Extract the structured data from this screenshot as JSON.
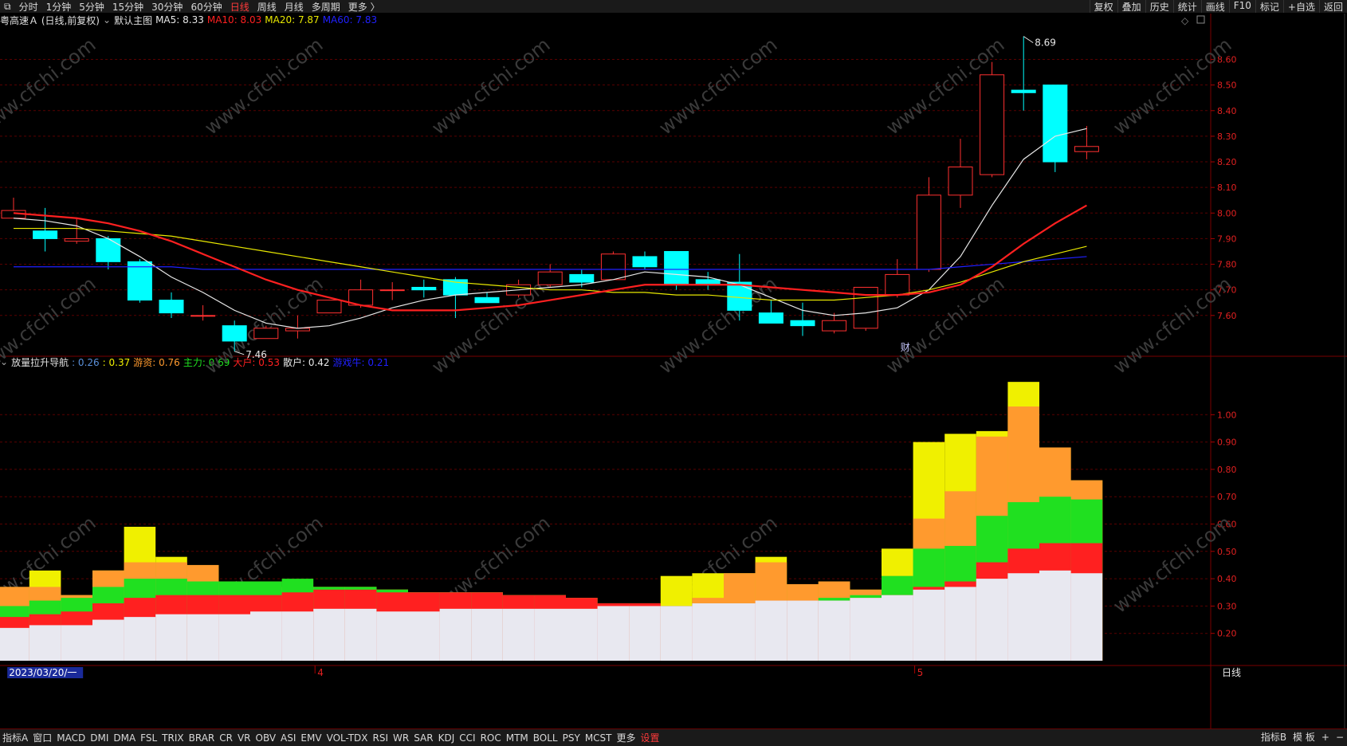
{
  "toolbar": {
    "left_items": [
      "分时",
      "1分钟",
      "5分钟",
      "15分钟",
      "30分钟",
      "60分钟",
      "日线",
      "周线",
      "月线",
      "多周期",
      "更多 〉"
    ],
    "active": "日线",
    "right_items": [
      "复权",
      "叠加",
      "历史",
      "统计",
      "画线",
      "F10",
      "标记",
      "+自选",
      "返回"
    ]
  },
  "main_legend": {
    "stock": "粤高速Ａ (日线,前复权)",
    "template": "默认主图",
    "ma": [
      {
        "label": "MA5: 8.33",
        "color": "#e8e8e8"
      },
      {
        "label": "MA10: 8.03",
        "color": "#ff2020"
      },
      {
        "label": "MA20: 7.87",
        "color": "#e8e800"
      },
      {
        "label": "MA60: 7.83",
        "color": "#2020ff"
      }
    ]
  },
  "sub_legend": {
    "name": "放量拉升导航",
    "items": [
      {
        "label": ": 0.26",
        "color": "#5a8fd8"
      },
      {
        "label": ": 0.37",
        "color": "#f0f000"
      },
      {
        "label": "游资: 0.76",
        "color": "#ff9a2e"
      },
      {
        "label": "主力: 0.69",
        "color": "#20e020"
      },
      {
        "label": "大户: 0.53",
        "color": "#ff2020"
      },
      {
        "label": "散户: 0.42",
        "color": "#e8e8e8"
      },
      {
        "label": "游戏牛: 0.21",
        "color": "#2020ff"
      }
    ]
  },
  "chart_data": [
    {
      "type": "candlestick",
      "title": "粤高速Ａ (日线,前复权)",
      "ylim": [
        7.45,
        8.72
      ],
      "y_ticks": [
        "8.60",
        "8.50",
        "8.40",
        "8.30",
        "8.20",
        "8.10",
        "8.00",
        "7.90",
        "7.80",
        "7.70",
        "7.60"
      ],
      "candles": [
        {
          "o": 7.98,
          "h": 8.06,
          "l": 7.98,
          "c": 8.01
        },
        {
          "o": 7.93,
          "h": 8.02,
          "l": 7.85,
          "c": 7.9
        },
        {
          "o": 7.89,
          "h": 7.98,
          "l": 7.88,
          "c": 7.9
        },
        {
          "o": 7.9,
          "h": 7.91,
          "l": 7.78,
          "c": 7.81
        },
        {
          "o": 7.81,
          "h": 7.82,
          "l": 7.65,
          "c": 7.66
        },
        {
          "o": 7.66,
          "h": 7.69,
          "l": 7.59,
          "c": 7.61
        },
        {
          "o": 7.6,
          "h": 7.64,
          "l": 7.58,
          "c": 7.6
        },
        {
          "o": 7.56,
          "h": 7.58,
          "l": 7.46,
          "c": 7.5
        },
        {
          "o": 7.51,
          "h": 7.56,
          "l": 7.51,
          "c": 7.55
        },
        {
          "o": 7.54,
          "h": 7.6,
          "l": 7.51,
          "c": 7.55
        },
        {
          "o": 7.61,
          "h": 7.66,
          "l": 7.61,
          "c": 7.66
        },
        {
          "o": 7.64,
          "h": 7.74,
          "l": 7.63,
          "c": 7.7
        },
        {
          "o": 7.7,
          "h": 7.73,
          "l": 7.66,
          "c": 7.7
        },
        {
          "o": 7.71,
          "h": 7.74,
          "l": 7.67,
          "c": 7.7
        },
        {
          "o": 7.74,
          "h": 7.75,
          "l": 7.59,
          "c": 7.68
        },
        {
          "o": 7.67,
          "h": 7.69,
          "l": 7.65,
          "c": 7.65
        },
        {
          "o": 7.68,
          "h": 7.74,
          "l": 7.67,
          "c": 7.72
        },
        {
          "o": 7.72,
          "h": 7.8,
          "l": 7.71,
          "c": 7.77
        },
        {
          "o": 7.76,
          "h": 7.78,
          "l": 7.71,
          "c": 7.73
        },
        {
          "o": 7.74,
          "h": 7.85,
          "l": 7.74,
          "c": 7.84
        },
        {
          "o": 7.83,
          "h": 7.85,
          "l": 7.78,
          "c": 7.79
        },
        {
          "o": 7.85,
          "h": 7.85,
          "l": 7.7,
          "c": 7.72
        },
        {
          "o": 7.74,
          "h": 7.77,
          "l": 7.7,
          "c": 7.72
        },
        {
          "o": 7.73,
          "h": 7.84,
          "l": 7.58,
          "c": 7.62
        },
        {
          "o": 7.61,
          "h": 7.66,
          "l": 7.57,
          "c": 7.57
        },
        {
          "o": 7.58,
          "h": 7.65,
          "l": 7.52,
          "c": 7.56
        },
        {
          "o": 7.54,
          "h": 7.61,
          "l": 7.53,
          "c": 7.58
        },
        {
          "o": 7.55,
          "h": 7.71,
          "l": 7.54,
          "c": 7.71
        },
        {
          "o": 7.68,
          "h": 7.82,
          "l": 7.67,
          "c": 7.76
        },
        {
          "o": 7.78,
          "h": 8.14,
          "l": 7.77,
          "c": 8.07
        },
        {
          "o": 8.07,
          "h": 8.29,
          "l": 8.02,
          "c": 8.18
        },
        {
          "o": 8.15,
          "h": 8.59,
          "l": 8.14,
          "c": 8.54
        },
        {
          "o": 8.48,
          "h": 8.69,
          "l": 8.4,
          "c": 8.47
        },
        {
          "o": 8.5,
          "h": 8.5,
          "l": 8.16,
          "c": 8.2
        },
        {
          "o": 8.24,
          "h": 8.34,
          "l": 8.21,
          "c": 8.26
        }
      ],
      "ma5": [
        7.98,
        7.97,
        7.95,
        7.9,
        7.83,
        7.75,
        7.69,
        7.62,
        7.57,
        7.55,
        7.56,
        7.59,
        7.63,
        7.66,
        7.68,
        7.69,
        7.7,
        7.71,
        7.72,
        7.74,
        7.77,
        7.76,
        7.75,
        7.72,
        7.67,
        7.62,
        7.6,
        7.61,
        7.63,
        7.7,
        7.83,
        8.03,
        8.21,
        8.3,
        8.33
      ],
      "ma10": [
        8.0,
        7.99,
        7.98,
        7.96,
        7.93,
        7.89,
        7.84,
        7.79,
        7.74,
        7.7,
        7.67,
        7.64,
        7.62,
        7.62,
        7.62,
        7.63,
        7.64,
        7.66,
        7.68,
        7.7,
        7.72,
        7.72,
        7.72,
        7.72,
        7.71,
        7.7,
        7.69,
        7.68,
        7.68,
        7.69,
        7.72,
        7.79,
        7.88,
        7.96,
        8.03
      ],
      "ma20": [
        7.94,
        7.94,
        7.94,
        7.93,
        7.92,
        7.91,
        7.89,
        7.87,
        7.85,
        7.83,
        7.81,
        7.79,
        7.77,
        7.75,
        7.73,
        7.72,
        7.71,
        7.7,
        7.7,
        7.69,
        7.69,
        7.68,
        7.68,
        7.67,
        7.66,
        7.66,
        7.66,
        7.67,
        7.68,
        7.7,
        7.73,
        7.77,
        7.81,
        7.84,
        7.87
      ],
      "ma60": [
        7.79,
        7.79,
        7.79,
        7.79,
        7.79,
        7.79,
        7.78,
        7.78,
        7.78,
        7.78,
        7.78,
        7.78,
        7.78,
        7.78,
        7.78,
        7.78,
        7.78,
        7.78,
        7.78,
        7.78,
        7.78,
        7.78,
        7.78,
        7.78,
        7.78,
        7.78,
        7.78,
        7.78,
        7.78,
        7.78,
        7.79,
        7.8,
        7.81,
        7.82,
        7.83
      ],
      "annotations": [
        {
          "label": "8.69",
          "price": 8.69
        },
        {
          "label": "7.46",
          "price": 7.46
        },
        {
          "label": "财"
        }
      ]
    },
    {
      "type": "bar",
      "title": "放量拉升导航",
      "ylim": [
        0.1,
        1.17
      ],
      "y_ticks": [
        "1.00",
        "0.90",
        "0.80",
        "0.70",
        "0.60",
        "0.50",
        "0.40",
        "0.30",
        "0.20"
      ],
      "series": [
        {
          "name": "散户",
          "color": "#e8e8f0",
          "values": [
            0.22,
            0.23,
            0.23,
            0.25,
            0.26,
            0.27,
            0.27,
            0.27,
            0.28,
            0.28,
            0.29,
            0.29,
            0.28,
            0.28,
            0.29,
            0.29,
            0.29,
            0.29,
            0.29,
            0.3,
            0.3,
            0.3,
            0.31,
            0.31,
            0.32,
            0.32,
            0.32,
            0.33,
            0.34,
            0.36,
            0.37,
            0.4,
            0.42,
            0.43,
            0.42
          ]
        },
        {
          "name": "大户",
          "color": "#ff2020",
          "values": [
            0.26,
            0.27,
            0.28,
            0.31,
            0.33,
            0.34,
            0.34,
            0.34,
            0.34,
            0.35,
            0.36,
            0.36,
            0.35,
            0.35,
            0.35,
            0.35,
            0.34,
            0.34,
            0.33,
            0.31,
            0.31,
            0.3,
            0.31,
            0.31,
            0.32,
            0.32,
            0.32,
            0.33,
            0.34,
            0.37,
            0.39,
            0.46,
            0.51,
            0.53,
            0.53
          ]
        },
        {
          "name": "主力",
          "color": "#20e020",
          "values": [
            0.3,
            0.32,
            0.33,
            0.37,
            0.4,
            0.4,
            0.39,
            0.39,
            0.39,
            0.4,
            0.37,
            0.37,
            0.36,
            0.35,
            0.35,
            0.35,
            0.34,
            0.34,
            0.33,
            0.31,
            0.31,
            0.3,
            0.31,
            0.31,
            0.32,
            0.32,
            0.33,
            0.34,
            0.41,
            0.51,
            0.52,
            0.63,
            0.68,
            0.7,
            0.69
          ]
        },
        {
          "name": "游资",
          "color": "#ff9a2e",
          "values": [
            0.37,
            0.37,
            0.34,
            0.43,
            0.46,
            0.46,
            0.45,
            0.39,
            0.39,
            0.37,
            0.37,
            0.37,
            0.36,
            0.35,
            0.35,
            0.35,
            0.34,
            0.34,
            0.33,
            0.31,
            0.31,
            0.3,
            0.33,
            0.42,
            0.46,
            0.38,
            0.39,
            0.36,
            0.41,
            0.62,
            0.72,
            0.92,
            1.03,
            0.88,
            0.76
          ]
        },
        {
          "name": "",
          "color": "#f0f000",
          "values": [
            0.37,
            0.43,
            0.34,
            0.43,
            0.59,
            0.48,
            0.45,
            0.39,
            0.39,
            0.37,
            0.37,
            0.37,
            0.36,
            0.35,
            0.35,
            0.35,
            0.34,
            0.34,
            0.33,
            0.31,
            0.31,
            0.41,
            0.42,
            0.42,
            0.48,
            0.38,
            0.39,
            0.36,
            0.51,
            0.9,
            0.93,
            0.94,
            1.12,
            0.88,
            0.76
          ]
        }
      ]
    }
  ],
  "x_axis": {
    "labels": [
      {
        "text": "2023/03/20/一",
        "index": 0,
        "highlight": true
      },
      {
        "text": "4",
        "index": 10
      },
      {
        "text": "5",
        "index": 29
      }
    ]
  },
  "bottom_tabs": [
    "指标A",
    "窗口",
    "MACD",
    "DMI",
    "DMA",
    "FSL",
    "TRIX",
    "BRAR",
    "CR",
    "VR",
    "OBV",
    "ASI",
    "EMV",
    "VOL-TDX",
    "RSI",
    "WR",
    "SAR",
    "KDJ",
    "CCI",
    "ROC",
    "MTM",
    "BOLL",
    "PSY",
    "MCST",
    "更多",
    "设置"
  ],
  "bottom_active": "设置",
  "bottom_right": [
    "指标B",
    "模 板",
    "+",
    "−"
  ],
  "period_label": "日线",
  "watermark": "www.cfchi.com"
}
